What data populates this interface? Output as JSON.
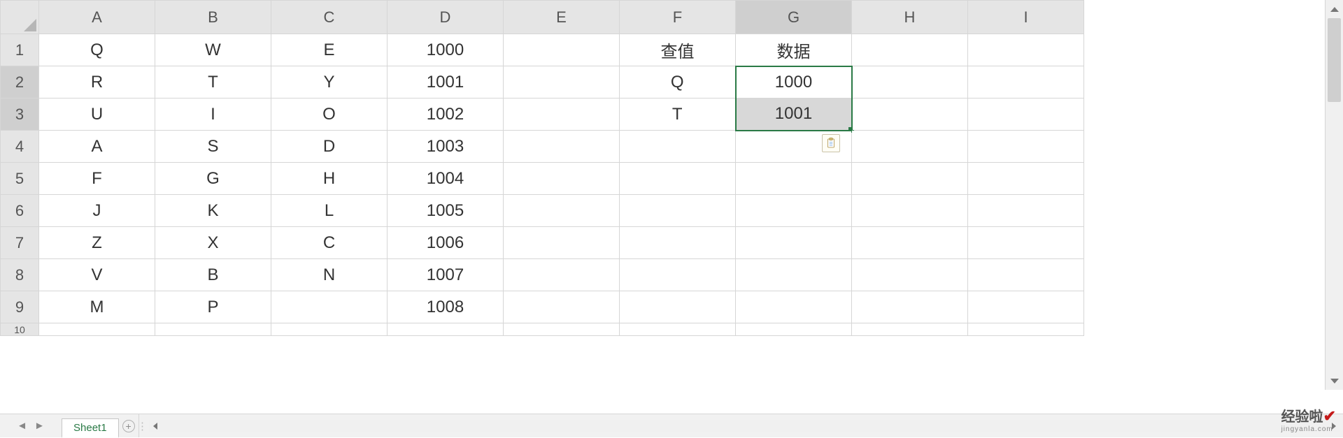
{
  "columns": [
    "A",
    "B",
    "C",
    "D",
    "E",
    "F",
    "G",
    "H",
    "I"
  ],
  "row_headers": [
    "1",
    "2",
    "3",
    "4",
    "5",
    "6",
    "7",
    "8",
    "9",
    "10"
  ],
  "grid": {
    "r1": {
      "A": "Q",
      "B": "W",
      "C": "E",
      "D": "1000",
      "E": "",
      "F": "查值",
      "G": "数据",
      "H": "",
      "I": ""
    },
    "r2": {
      "A": "R",
      "B": "T",
      "C": "Y",
      "D": "1001",
      "E": "",
      "F": "Q",
      "G": "1000",
      "H": "",
      "I": ""
    },
    "r3": {
      "A": "U",
      "B": "I",
      "C": "O",
      "D": "1002",
      "E": "",
      "F": "T",
      "G": "1001",
      "H": "",
      "I": ""
    },
    "r4": {
      "A": "A",
      "B": "S",
      "C": "D",
      "D": "1003",
      "E": "",
      "F": "",
      "G": "",
      "H": "",
      "I": ""
    },
    "r5": {
      "A": "F",
      "B": "G",
      "C": "H",
      "D": "1004",
      "E": "",
      "F": "",
      "G": "",
      "H": "",
      "I": ""
    },
    "r6": {
      "A": "J",
      "B": "K",
      "C": "L",
      "D": "1005",
      "E": "",
      "F": "",
      "G": "",
      "H": "",
      "I": ""
    },
    "r7": {
      "A": "Z",
      "B": "X",
      "C": "C",
      "D": "1006",
      "E": "",
      "F": "",
      "G": "",
      "H": "",
      "I": ""
    },
    "r8": {
      "A": "V",
      "B": "B",
      "C": "N",
      "D": "1007",
      "E": "",
      "F": "",
      "G": "",
      "H": "",
      "I": ""
    },
    "r9": {
      "A": "M",
      "B": "P",
      "C": "",
      "D": "1008",
      "E": "",
      "F": "",
      "G": "",
      "H": "",
      "I": ""
    },
    "r10": {
      "A": "",
      "B": "",
      "C": "",
      "D": "",
      "E": "",
      "F": "",
      "G": "",
      "H": "",
      "I": ""
    }
  },
  "selection": {
    "range": "G2:G3",
    "active": "G2"
  },
  "sheet_tabs": {
    "active": "Sheet1"
  },
  "watermark": {
    "brand_cn": "经验啦",
    "check": "✔",
    "url": "jingyanla.com"
  }
}
